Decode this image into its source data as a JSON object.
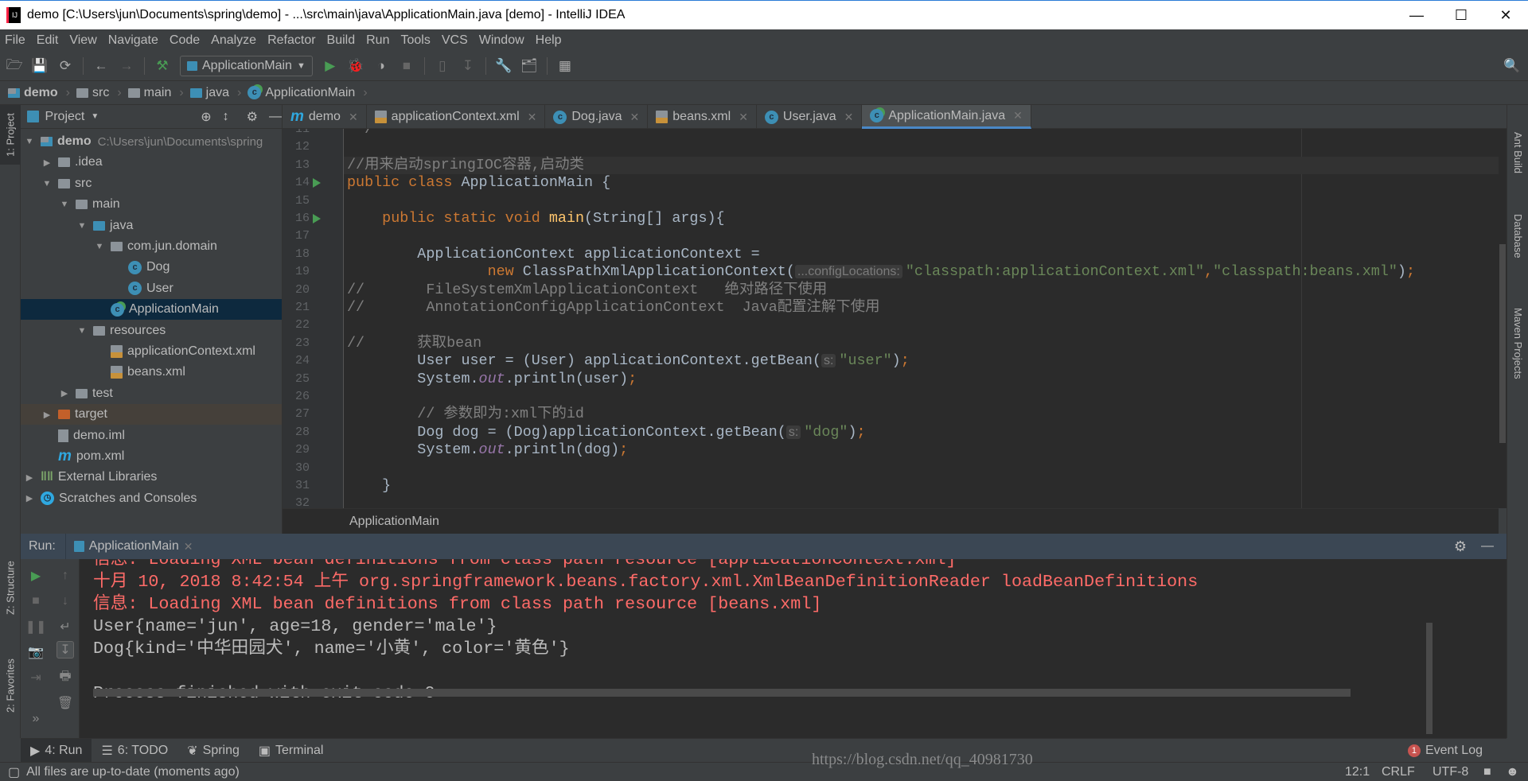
{
  "window": {
    "title": "demo [C:\\Users\\jun\\Documents\\spring\\demo] - ...\\src\\main\\java\\ApplicationMain.java [demo] - IntelliJ IDEA"
  },
  "menu": [
    "File",
    "Edit",
    "View",
    "Navigate",
    "Code",
    "Analyze",
    "Refactor",
    "Build",
    "Run",
    "Tools",
    "VCS",
    "Window",
    "Help"
  ],
  "toolbar": {
    "run_config": "ApplicationMain"
  },
  "breadcrumb": [
    "demo",
    "src",
    "main",
    "java",
    "ApplicationMain"
  ],
  "left_strip": {
    "project": "1: Project",
    "structure": "Z: Structure",
    "favorites": "2: Favorites"
  },
  "right_strip": {
    "ant": "Ant Build",
    "database": "Database",
    "maven": "Maven Projects"
  },
  "project": {
    "header": "Project",
    "tree": [
      {
        "label": "demo",
        "path": "C:\\Users\\jun\\Documents\\spring",
        "depth": 0,
        "arrow": "down",
        "icon": "module-folder-icon"
      },
      {
        "label": ".idea",
        "depth": 1,
        "arrow": "right",
        "icon": "folder-icon"
      },
      {
        "label": "src",
        "depth": 1,
        "arrow": "down",
        "icon": "folder-icon"
      },
      {
        "label": "main",
        "depth": 2,
        "arrow": "down",
        "icon": "folder-icon"
      },
      {
        "label": "java",
        "depth": 3,
        "arrow": "down",
        "icon": "source-folder-icon"
      },
      {
        "label": "com.jun.domain",
        "depth": 4,
        "arrow": "down",
        "icon": "package-icon"
      },
      {
        "label": "Dog",
        "depth": 5,
        "arrow": "",
        "icon": "class-icon"
      },
      {
        "label": "User",
        "depth": 5,
        "arrow": "",
        "icon": "class-icon"
      },
      {
        "label": "ApplicationMain",
        "depth": 4,
        "arrow": "",
        "icon": "runnable-class-icon",
        "selected": true
      },
      {
        "label": "resources",
        "depth": 3,
        "arrow": "down",
        "icon": "resources-folder-icon"
      },
      {
        "label": "applicationContext.xml",
        "depth": 4,
        "arrow": "",
        "icon": "spring-xml-icon"
      },
      {
        "label": "beans.xml",
        "depth": 4,
        "arrow": "",
        "icon": "spring-xml-icon"
      },
      {
        "label": "test",
        "depth": 2,
        "arrow": "right",
        "icon": "folder-icon"
      },
      {
        "label": "target",
        "depth": 1,
        "arrow": "right",
        "icon": "excluded-folder-icon",
        "target": true
      },
      {
        "label": "demo.iml",
        "depth": 1,
        "arrow": "",
        "icon": "iml-file-icon"
      },
      {
        "label": "pom.xml",
        "depth": 1,
        "arrow": "",
        "icon": "maven-icon"
      },
      {
        "label": "External Libraries",
        "depth": 0,
        "arrow": "right",
        "icon": "libraries-icon"
      },
      {
        "label": "Scratches and Consoles",
        "depth": 0,
        "arrow": "right",
        "icon": "scratches-icon"
      }
    ]
  },
  "tabs": [
    {
      "label": "demo",
      "icon": "maven-icon"
    },
    {
      "label": "applicationContext.xml",
      "icon": "spring-xml-icon"
    },
    {
      "label": "Dog.java",
      "icon": "class-icon"
    },
    {
      "label": "beans.xml",
      "icon": "spring-xml-icon"
    },
    {
      "label": "User.java",
      "icon": "class-icon"
    },
    {
      "label": "ApplicationMain.java",
      "icon": "runnable-class-icon",
      "active": true
    }
  ],
  "editor": {
    "caret_line": 13,
    "run_markers": [
      14,
      16
    ],
    "lines": [
      {
        "n": 11,
        "tokens": [
          {
            "t": "cm",
            "v": " */"
          }
        ]
      },
      {
        "n": 12,
        "tokens": []
      },
      {
        "n": 13,
        "tokens": [
          {
            "t": "cm",
            "v": "//用来启动springIOC容器,启动类"
          }
        ]
      },
      {
        "n": 14,
        "tokens": [
          {
            "t": "kw",
            "v": "public class "
          },
          {
            "t": "p",
            "v": "ApplicationMain {"
          }
        ]
      },
      {
        "n": 15,
        "tokens": []
      },
      {
        "n": 16,
        "tokens": [
          {
            "t": "p",
            "v": "    "
          },
          {
            "t": "kw",
            "v": "public static void "
          },
          {
            "t": "fn",
            "v": "main"
          },
          {
            "t": "p",
            "v": "(String[] args){"
          }
        ]
      },
      {
        "n": 17,
        "tokens": []
      },
      {
        "n": 18,
        "tokens": [
          {
            "t": "p",
            "v": "        ApplicationContext applicationContext ="
          }
        ]
      },
      {
        "n": 19,
        "tokens": [
          {
            "t": "p",
            "v": "                "
          },
          {
            "t": "kw",
            "v": "new "
          },
          {
            "t": "p",
            "v": "ClassPathXmlApplicationContext("
          },
          {
            "t": "hint",
            "v": "...configLocations:"
          },
          {
            "t": "str",
            "v": "\"classpath:applicationContext.xml\""
          },
          {
            "t": "kw",
            "v": ","
          },
          {
            "t": "str",
            "v": "\"classpath:beans.xml\""
          },
          {
            "t": "p",
            "v": ")"
          },
          {
            "t": "kw",
            "v": ";"
          }
        ]
      },
      {
        "n": 20,
        "tokens": [
          {
            "t": "cm",
            "v": "//       FileSystemXmlApplicationContext   绝对路径下使用"
          }
        ]
      },
      {
        "n": 21,
        "tokens": [
          {
            "t": "cm",
            "v": "//       AnnotationConfigApplicationContext  Java配置注解下使用"
          }
        ]
      },
      {
        "n": 22,
        "tokens": []
      },
      {
        "n": 23,
        "tokens": [
          {
            "t": "cm",
            "v": "//      获取bean"
          }
        ]
      },
      {
        "n": 24,
        "tokens": [
          {
            "t": "p",
            "v": "        User user = (User) applicationContext.getBean("
          },
          {
            "t": "hint",
            "v": "s:"
          },
          {
            "t": "str",
            "v": "\"user\""
          },
          {
            "t": "p",
            "v": ")"
          },
          {
            "t": "kw",
            "v": ";"
          }
        ]
      },
      {
        "n": 25,
        "tokens": [
          {
            "t": "p",
            "v": "        System."
          },
          {
            "t": "st",
            "v": "out"
          },
          {
            "t": "p",
            "v": ".println(user)"
          },
          {
            "t": "kw",
            "v": ";"
          }
        ]
      },
      {
        "n": 26,
        "tokens": []
      },
      {
        "n": 27,
        "tokens": [
          {
            "t": "p",
            "v": "        "
          },
          {
            "t": "cm",
            "v": "// 参数即为:xml下的id"
          }
        ]
      },
      {
        "n": 28,
        "tokens": [
          {
            "t": "p",
            "v": "        Dog dog = (Dog)applicationContext.getBean("
          },
          {
            "t": "hint",
            "v": "s:"
          },
          {
            "t": "str",
            "v": "\"dog\""
          },
          {
            "t": "p",
            "v": ")"
          },
          {
            "t": "kw",
            "v": ";"
          }
        ]
      },
      {
        "n": 29,
        "tokens": [
          {
            "t": "p",
            "v": "        System."
          },
          {
            "t": "st",
            "v": "out"
          },
          {
            "t": "p",
            "v": ".println(dog)"
          },
          {
            "t": "kw",
            "v": ";"
          }
        ]
      },
      {
        "n": 30,
        "tokens": []
      },
      {
        "n": 31,
        "tokens": [
          {
            "t": "p",
            "v": "    }"
          }
        ]
      },
      {
        "n": 32,
        "tokens": []
      }
    ],
    "footer_crumb": "ApplicationMain"
  },
  "run": {
    "label": "Run:",
    "tab": "ApplicationMain",
    "console": [
      {
        "text": "信息: Loading XML bean definitions from class path resource [applicationContext.xml]",
        "level": "err"
      },
      {
        "text": "十月 10, 2018 8:42:54 上午 org.springframework.beans.factory.xml.XmlBeanDefinitionReader loadBeanDefinitions",
        "level": "err"
      },
      {
        "text": "信息: Loading XML bean definitions from class path resource [beans.xml]",
        "level": "err"
      },
      {
        "text": "User{name='jun', age=18, gender='male'}",
        "level": "out"
      },
      {
        "text": "Dog{kind='中华田园犬', name='小黄', color='黄色'}",
        "level": "out"
      },
      {
        "text": "",
        "level": "out"
      },
      {
        "text": "Process finished with exit code 0",
        "level": "out"
      }
    ]
  },
  "bottom_tabs": [
    {
      "label": "4: Run",
      "icon": "run-icon",
      "active": true
    },
    {
      "label": "6: TODO",
      "icon": "todo-icon"
    },
    {
      "label": "Spring",
      "icon": "spring-icon"
    },
    {
      "label": "Terminal",
      "icon": "terminal-icon"
    }
  ],
  "event_log": {
    "label": "Event Log",
    "count": "1"
  },
  "status": {
    "message": "All files are up-to-date (moments ago)",
    "position": "12:1",
    "line_sep": "CRLF",
    "encoding": "UTF-8"
  },
  "watermark": "https://blog.csdn.net/qq_40981730",
  "colors": {
    "keyword": "#cc7832",
    "string": "#6a8759",
    "comment": "#808080",
    "error_output": "#ff6b68",
    "selection": "#0d293e",
    "accent": "#4a88c7"
  }
}
